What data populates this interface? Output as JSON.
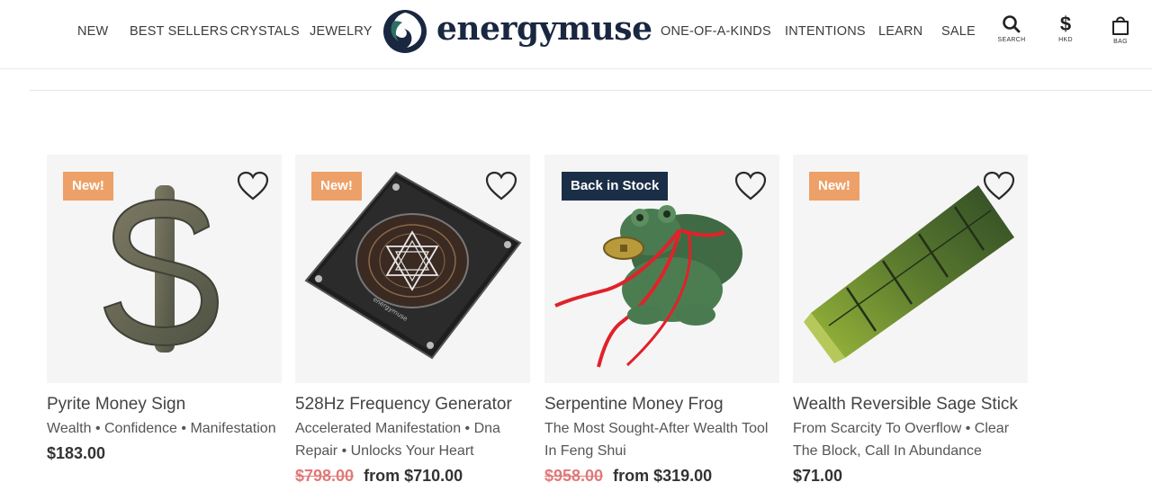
{
  "nav": {
    "left": [
      "NEW",
      "BEST SELLERS",
      "CRYSTALS",
      "JEWELRY"
    ],
    "right": [
      "ONE-OF-A-KINDS",
      "INTENTIONS",
      "LEARN",
      "SALE"
    ]
  },
  "brand": {
    "name": "energymuse"
  },
  "utilities": {
    "search": "SEARCH",
    "currency_symbol": "$",
    "currency": "HKD",
    "bag": "BAG"
  },
  "products": [
    {
      "badge": "New!",
      "title": "Pyrite Money Sign",
      "subtitle": "Wealth • Confidence • Manifestation",
      "old_price": "",
      "price": "$183.00"
    },
    {
      "badge": "New!",
      "title": "528Hz Frequency Generator",
      "subtitle": "Accelerated Manifestation • Dna Repair • Unlocks Your Heart",
      "old_price": "$798.00",
      "price": "from $710.00"
    },
    {
      "badge": "Back in Stock",
      "title": "Serpentine Money Frog",
      "subtitle": "The Most Sought-After Wealth Tool In Feng Shui",
      "old_price": "$958.00",
      "price": "from $319.00"
    },
    {
      "badge": "New!",
      "title": "Wealth Reversible Sage Stick",
      "subtitle": "From Scarcity To Overflow • Clear The Block, Call In Abundance",
      "old_price": "",
      "price": "$71.00"
    }
  ],
  "colors": {
    "badge_new": "#eda168",
    "badge_stock": "#1b2e47",
    "strike_price": "#e07a7a",
    "brand_navy": "#1a2740",
    "brand_teal": "#2e6f63"
  },
  "icons": [
    "search-icon",
    "dollar-icon",
    "bag-icon",
    "heart-icon"
  ]
}
